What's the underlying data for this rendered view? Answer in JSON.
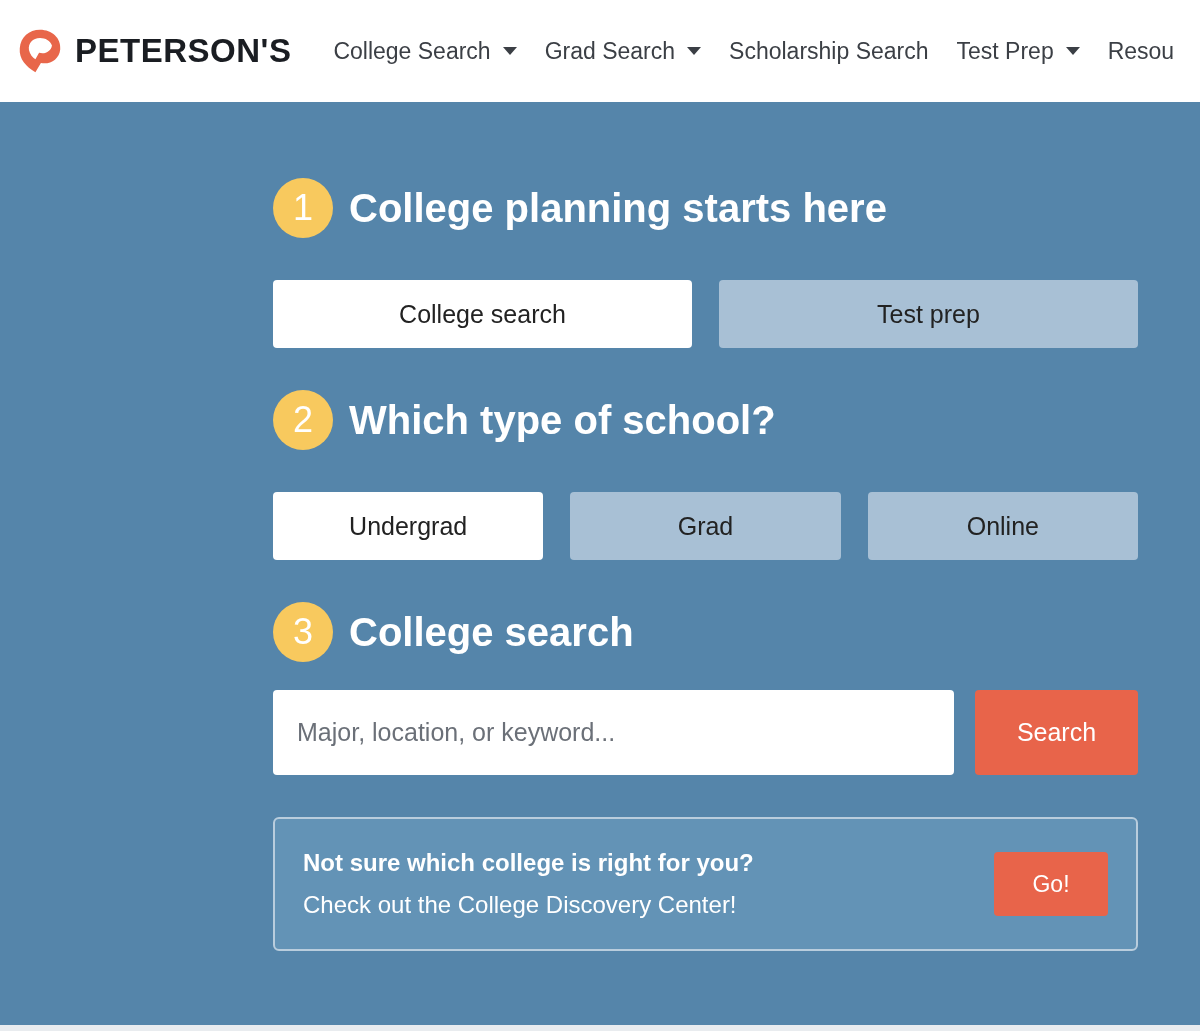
{
  "header": {
    "logo": "PETERSON'S",
    "nav": [
      {
        "label": "College Search",
        "dropdown": true
      },
      {
        "label": "Grad Search",
        "dropdown": true
      },
      {
        "label": "Scholarship Search",
        "dropdown": false
      },
      {
        "label": "Test Prep",
        "dropdown": true
      },
      {
        "label": "Resou",
        "dropdown": false
      }
    ]
  },
  "steps": [
    {
      "number": "1",
      "title": "College planning starts here",
      "kind": "choices",
      "options": [
        {
          "label": "College search",
          "selected": true
        },
        {
          "label": "Test prep",
          "selected": false
        }
      ]
    },
    {
      "number": "2",
      "title": "Which type of school?",
      "kind": "choices",
      "options": [
        {
          "label": "Undergrad",
          "selected": true
        },
        {
          "label": "Grad",
          "selected": false
        },
        {
          "label": "Online",
          "selected": false
        }
      ]
    },
    {
      "number": "3",
      "title": "College search",
      "kind": "search",
      "placeholder": "Major, location, or keyword...",
      "button": "Search"
    }
  ],
  "promo": {
    "title": "Not sure which college is right for you?",
    "text": "Check out the College Discovery Center!",
    "button": "Go!"
  }
}
